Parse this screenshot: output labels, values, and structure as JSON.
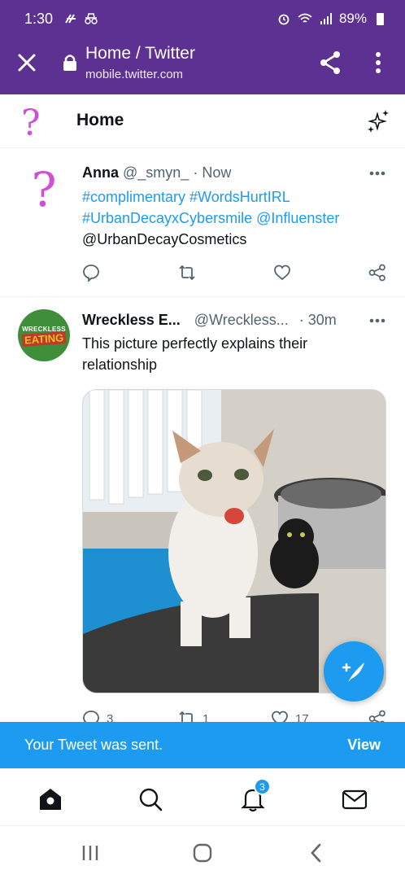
{
  "status_bar": {
    "time": "1:30",
    "battery": "89%",
    "icons": [
      "nfc-icon",
      "incognito-icon",
      "alarm-icon",
      "wifi-icon",
      "signal-icon",
      "battery-icon"
    ]
  },
  "browser": {
    "title": "Home / Twitter",
    "url": "mobile.twitter.com",
    "bg_color": "#5c3192"
  },
  "home_header": {
    "title": "Home"
  },
  "tweets": [
    {
      "name": "Anna",
      "handle": "@_smyn_",
      "time": "Now",
      "lines": [
        "#complimentary #WordsHurtIRL",
        "#UrbanDecayxCybersmile @Influenster",
        "@UrbanDecayCosmetics"
      ]
    },
    {
      "name": "Wreckless E...",
      "handle": "@Wreckless...",
      "time": "30m",
      "avatar_text": [
        "WRECKLESS",
        "EATING"
      ],
      "text": "This picture perfectly explains their relationship",
      "replies": "3",
      "retweets": "1",
      "likes": "17"
    }
  ],
  "toast": {
    "message": "Your Tweet was sent.",
    "action": "View"
  },
  "bottom_nav": {
    "notification_count": "3"
  },
  "colors": {
    "accent": "#1d9bf0",
    "browser": "#5c3192",
    "avatar_question": "#d04fd8"
  }
}
